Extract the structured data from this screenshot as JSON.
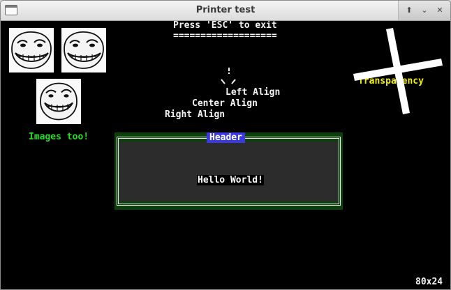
{
  "window": {
    "title": "Printer test"
  },
  "titlebar": {
    "app_icon": "terminal-window-icon",
    "buttons": {
      "up": "⬆",
      "minimize": "⌄",
      "close": "✕"
    }
  },
  "screen": {
    "exit_prompt": "Press 'ESC' to exit",
    "exit_underline": "===================",
    "align_left": "Left Align",
    "align_center": "Center Align",
    "align_right": "Right Align",
    "images_caption": "Images too!",
    "transparency_label": "Transparency",
    "size_readout": "80x24"
  },
  "dialog": {
    "header": "Header",
    "body": "Hello World!"
  },
  "colors": {
    "background": "#000000",
    "text": "#f2f2f2",
    "images_caption": "#22dd22",
    "transparency_label": "#f2f200",
    "dialog_bg": "#0b400b",
    "dialog_header": "#3a3ade"
  }
}
